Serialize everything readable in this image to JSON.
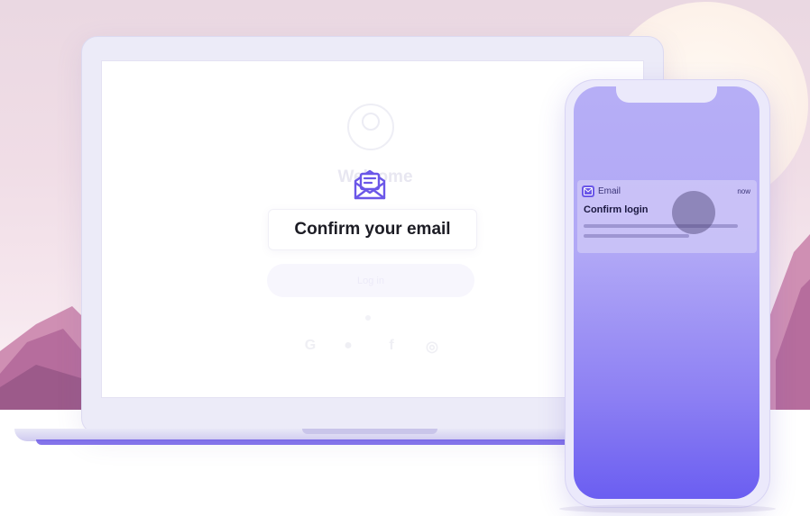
{
  "laptop": {
    "ghost_title": "Welcome",
    "confirm_text": "Confirm your email",
    "ghost_button": "Log in",
    "social_icons": [
      "google-icon",
      "apple-icon",
      "facebook-icon",
      "instagram-icon"
    ]
  },
  "notification": {
    "app_name": "Email",
    "time": "now",
    "title": "Confirm login"
  },
  "colors": {
    "accent": "#6b57e8",
    "phone_gradient_top": "#b6aef6",
    "phone_gradient_bottom": "#6b5ef1"
  }
}
